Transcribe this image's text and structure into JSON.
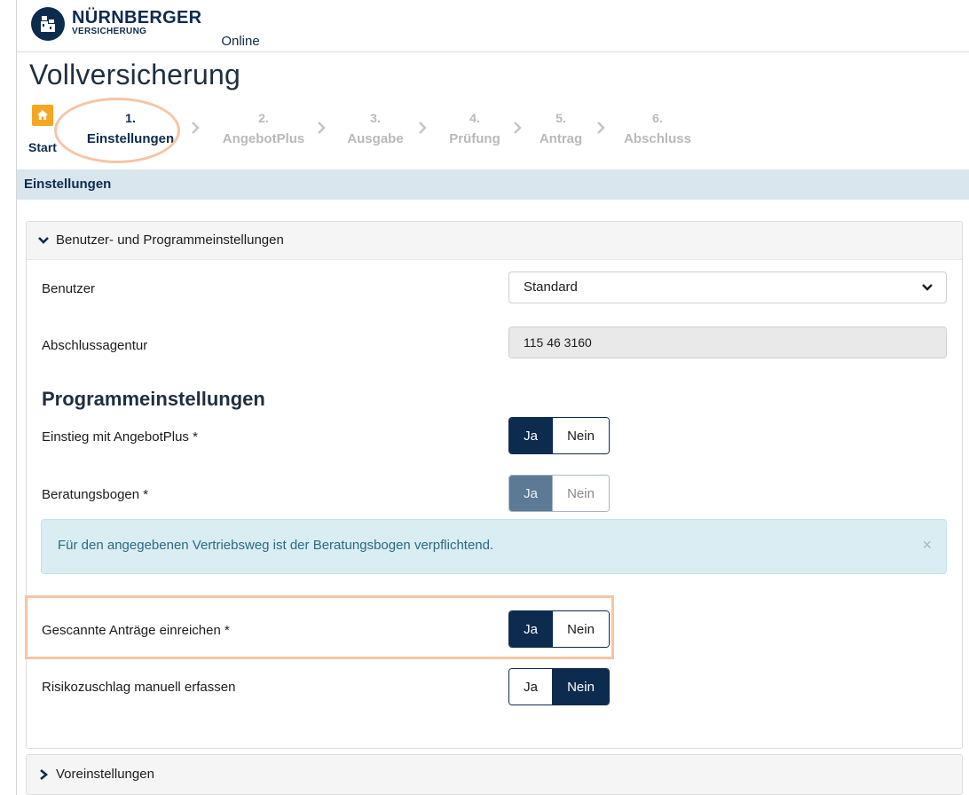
{
  "brand": {
    "name": "NÜRNBERGER",
    "sub": "VERSICHERUNG",
    "product": "Online"
  },
  "page_title": "Vollversicherung",
  "stepper": {
    "start_label": "Start",
    "steps": [
      {
        "num": "1.",
        "label": "Einstellungen",
        "active": true
      },
      {
        "num": "2.",
        "label": "AngebotPlus",
        "active": false
      },
      {
        "num": "3.",
        "label": "Ausgabe",
        "active": false
      },
      {
        "num": "4.",
        "label": "Prüfung",
        "active": false
      },
      {
        "num": "5.",
        "label": "Antrag",
        "active": false
      },
      {
        "num": "6.",
        "label": "Abschluss",
        "active": false
      }
    ]
  },
  "section_title": "Einstellungen",
  "panel": {
    "title": "Benutzer- und Programmeinstellungen",
    "benutzer_label": "Benutzer",
    "benutzer_value": "Standard",
    "agentur_label": "Abschlussagentur",
    "agentur_value": "115 46 3160",
    "subheading": "Programmeinstellungen",
    "toggles": [
      {
        "label": "Einstieg mit AngebotPlus *",
        "ja": "Ja",
        "nein": "Nein",
        "selected": "Ja",
        "disabled": false
      },
      {
        "label": "Beratungsbogen *",
        "ja": "Ja",
        "nein": "Nein",
        "selected": "Ja",
        "disabled": true
      },
      {
        "label": "Gescannte Anträge einreichen *",
        "ja": "Ja",
        "nein": "Nein",
        "selected": "Ja",
        "disabled": false
      },
      {
        "label": "Risikozuschlag manuell erfassen",
        "ja": "Ja",
        "nein": "Nein",
        "selected": "Nein",
        "disabled": false
      }
    ],
    "alert": {
      "message": "Für den angegebenen Vertriebsweg ist der Beratungsbogen verpflichtend.",
      "close": "×"
    }
  },
  "panel2": {
    "title": "Voreinstellungen"
  },
  "colors": {
    "navy": "#0d2b4e",
    "orange": "#f5a623",
    "highlight": "#f6c4a6",
    "section_bg": "#d9e6ee",
    "alert_bg": "#d9edf3"
  }
}
